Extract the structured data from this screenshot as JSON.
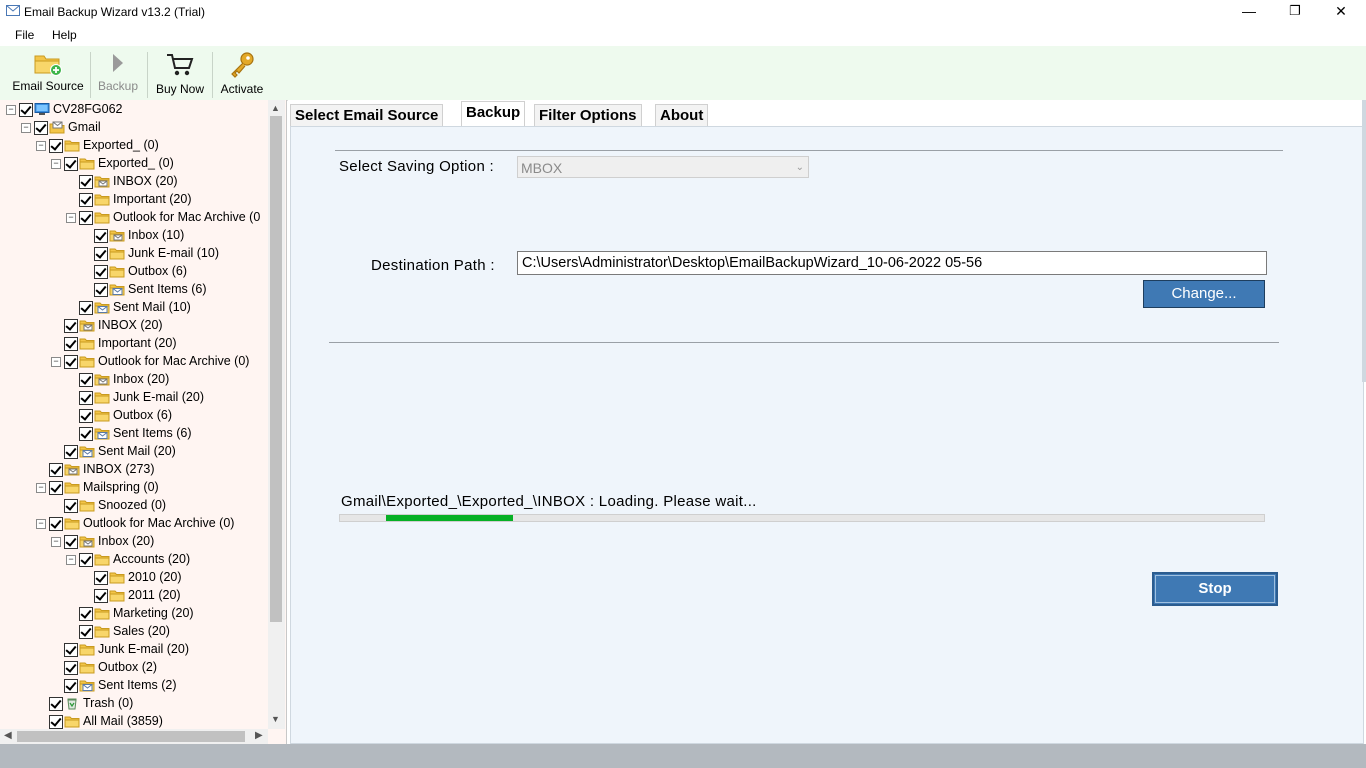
{
  "window": {
    "title": "Email Backup Wizard v13.2 (Trial)",
    "minimize": "—",
    "maximize": "❐",
    "close": "✕"
  },
  "menu": {
    "file": "File",
    "help": "Help"
  },
  "toolbar": {
    "email_source": "Email Source",
    "backup": "Backup",
    "buy_now": "Buy Now",
    "activate": "Activate"
  },
  "tree": [
    {
      "label": "CV28FG062",
      "level": 0,
      "expander": "-",
      "icon": "computer"
    },
    {
      "label": "Gmail",
      "level": 1,
      "expander": "-",
      "icon": "mailbox"
    },
    {
      "label": "Exported_ (0)",
      "level": 2,
      "expander": "-",
      "icon": "folder"
    },
    {
      "label": "Exported_ (0)",
      "level": 3,
      "expander": "-",
      "icon": "folder"
    },
    {
      "label": "INBOX (20)",
      "level": 4,
      "expander": "",
      "icon": "inbox"
    },
    {
      "label": "Important (20)",
      "level": 4,
      "expander": "",
      "icon": "folder"
    },
    {
      "label": "Outlook for Mac Archive (0",
      "level": 4,
      "expander": "-",
      "icon": "folder"
    },
    {
      "label": "Inbox (10)",
      "level": 5,
      "expander": "",
      "icon": "inbox"
    },
    {
      "label": "Junk E-mail (10)",
      "level": 5,
      "expander": "",
      "icon": "folder"
    },
    {
      "label": "Outbox (6)",
      "level": 5,
      "expander": "",
      "icon": "folder"
    },
    {
      "label": "Sent Items (6)",
      "level": 5,
      "expander": "",
      "icon": "sent"
    },
    {
      "label": "Sent Mail (10)",
      "level": 4,
      "expander": "",
      "icon": "sent"
    },
    {
      "label": "INBOX (20)",
      "level": 3,
      "expander": "",
      "icon": "inbox"
    },
    {
      "label": "Important (20)",
      "level": 3,
      "expander": "",
      "icon": "folder"
    },
    {
      "label": "Outlook for Mac Archive (0)",
      "level": 3,
      "expander": "-",
      "icon": "folder"
    },
    {
      "label": "Inbox (20)",
      "level": 4,
      "expander": "",
      "icon": "inbox"
    },
    {
      "label": "Junk E-mail (20)",
      "level": 4,
      "expander": "",
      "icon": "folder"
    },
    {
      "label": "Outbox (6)",
      "level": 4,
      "expander": "",
      "icon": "folder"
    },
    {
      "label": "Sent Items (6)",
      "level": 4,
      "expander": "",
      "icon": "sent"
    },
    {
      "label": "Sent Mail (20)",
      "level": 3,
      "expander": "",
      "icon": "sent"
    },
    {
      "label": "INBOX (273)",
      "level": 2,
      "expander": "",
      "icon": "inbox"
    },
    {
      "label": "Mailspring (0)",
      "level": 2,
      "expander": "-",
      "icon": "folder"
    },
    {
      "label": "Snoozed (0)",
      "level": 3,
      "expander": "",
      "icon": "folder"
    },
    {
      "label": "Outlook for Mac Archive (0)",
      "level": 2,
      "expander": "-",
      "icon": "folder"
    },
    {
      "label": "Inbox (20)",
      "level": 3,
      "expander": "-",
      "icon": "inbox"
    },
    {
      "label": "Accounts (20)",
      "level": 4,
      "expander": "-",
      "icon": "folder"
    },
    {
      "label": "2010 (20)",
      "level": 5,
      "expander": "",
      "icon": "folder"
    },
    {
      "label": "2011 (20)",
      "level": 5,
      "expander": "",
      "icon": "folder"
    },
    {
      "label": "Marketing (20)",
      "level": 4,
      "expander": "",
      "icon": "folder"
    },
    {
      "label": "Sales (20)",
      "level": 4,
      "expander": "",
      "icon": "folder"
    },
    {
      "label": "Junk E-mail (20)",
      "level": 3,
      "expander": "",
      "icon": "folder"
    },
    {
      "label": "Outbox (2)",
      "level": 3,
      "expander": "",
      "icon": "folder"
    },
    {
      "label": "Sent Items (2)",
      "level": 3,
      "expander": "",
      "icon": "sent"
    },
    {
      "label": "Trash (0)",
      "level": 2,
      "expander": "",
      "icon": "trash"
    },
    {
      "label": "All Mail (3859)",
      "level": 2,
      "expander": "",
      "icon": "folder"
    }
  ],
  "tabs": {
    "select_source": "Select Email Source",
    "backup": "Backup",
    "filter": "Filter Options",
    "about": "About"
  },
  "backup": {
    "saving_label": "Select Saving Option :",
    "saving_value": "MBOX",
    "dest_label": "Destination Path :",
    "dest_value": "C:\\Users\\Administrator\\Desktop\\EmailBackupWizard_10-06-2022 05-56",
    "change_label": "Change...",
    "status_text": "Gmail\\Exported_\\Exported_\\INBOX : Loading. Please wait...",
    "progress": 0.137,
    "stop_label": "Stop"
  },
  "colors": {
    "accent_button": "#3f79b4",
    "progress_fill": "#06b025",
    "toolbar_bg": "#eefaee",
    "tree_bg": "#fff5f2",
    "content_bg": "#eff5fb"
  }
}
